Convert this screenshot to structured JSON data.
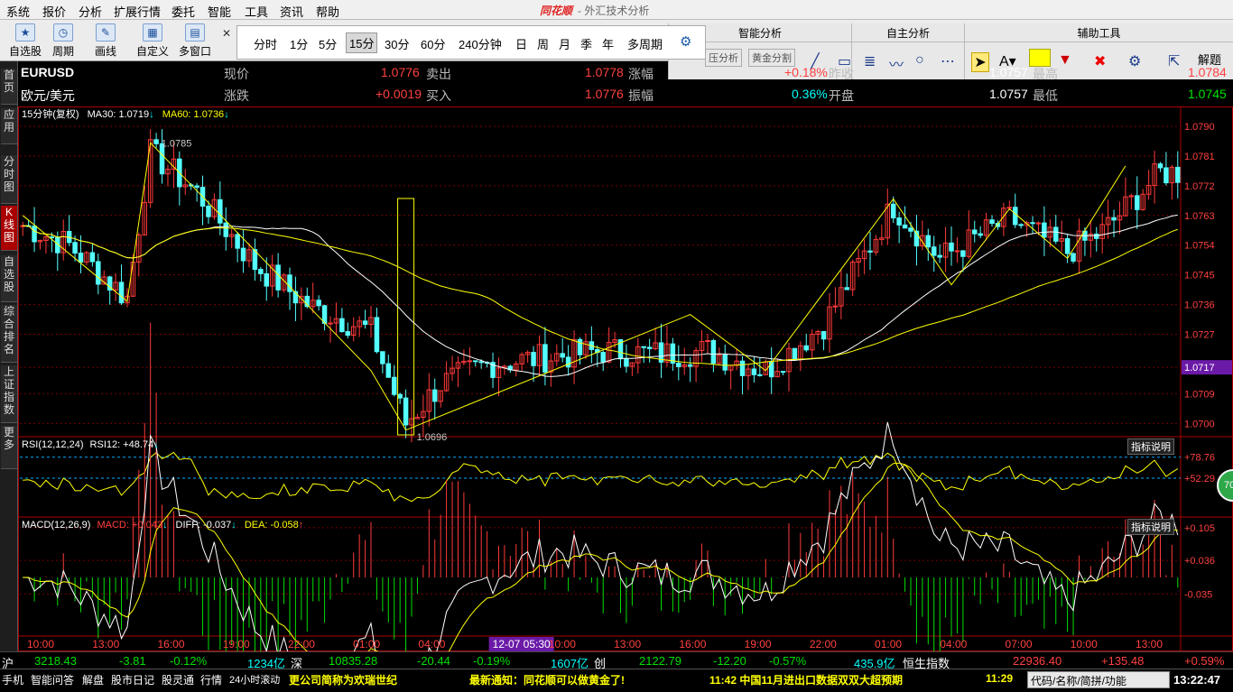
{
  "menu": [
    "系统",
    "报价",
    "分析",
    "扩展行情",
    "委托",
    "智能",
    "工具",
    "资讯",
    "帮助"
  ],
  "app_title": {
    "brand": "同花顺",
    "subtitle": "- 外汇技术分析"
  },
  "toolbar": {
    "buttons": [
      {
        "label": "自选股",
        "icon": "star-icon"
      },
      {
        "label": "周期",
        "icon": "clock-icon"
      },
      {
        "label": "画线",
        "icon": "pen-icon"
      },
      {
        "label": "自定义",
        "icon": "grid-icon"
      },
      {
        "label": "多窗口",
        "icon": "window-icon"
      }
    ],
    "periods": [
      "分时",
      "1分",
      "5分",
      "15分",
      "30分",
      "60分",
      "240分钟",
      "日",
      "周",
      "月",
      "季",
      "年",
      "多周期"
    ],
    "selected_period": "15分",
    "sections": [
      {
        "title": "智能分析",
        "buttons": [
          "压分析",
          "黄金分割"
        ]
      },
      {
        "title": "自主分析"
      },
      {
        "title": "辅助工具",
        "last": "解题"
      }
    ]
  },
  "leftnav": [
    "首页",
    "应用",
    "分时图",
    "K线图",
    "自选股",
    "综合排名",
    "上证指数",
    "更多"
  ],
  "quote": {
    "symbol": "EURUSD",
    "name": "欧元/美元",
    "labels": {
      "price": "现价",
      "change": "涨跌",
      "sell": "卖出",
      "buy": "买入",
      "pct": "涨幅",
      "amp": "振幅",
      "prev": "昨收",
      "open": "开盘",
      "high": "最高",
      "low": "最低"
    },
    "price": "1.0776",
    "change": "+0.0019",
    "sell": "1.0778",
    "buy": "1.0776",
    "pct": "+0.18%",
    "amp": "0.36%",
    "prev": "1.0757",
    "open": "1.0757",
    "high": "1.0784",
    "low": "1.0745"
  },
  "ma": {
    "period_label": "15分钟(复权)",
    "ma30": "MA30: 1.0719",
    "ma60": "MA60: 1.0736"
  },
  "chart_data": {
    "type": "candlestick",
    "ylim": [
      1.0696,
      1.079
    ],
    "y_ticks": [
      "1.0790",
      "1.0781",
      "1.0772",
      "1.0763",
      "1.0754",
      "1.0745",
      "1.0736",
      "1.0727",
      "1.0717",
      "1.0709",
      "1.0700"
    ],
    "x_ticks": [
      "10:00",
      "13:00",
      "16:00",
      "19:00",
      "22:00",
      "01:00",
      "04:00",
      "12-07 05:30",
      "10:00",
      "13:00",
      "16:00",
      "19:00",
      "22:00",
      "01:00",
      "04:00",
      "07:00",
      "10:00",
      "13:00"
    ],
    "highlight_price": "1.0717",
    "annotations": {
      "high": "1.0785",
      "low": "1.0696"
    },
    "zigzag": [
      [
        0,
        1.0763
      ],
      [
        18,
        1.0737
      ],
      [
        22,
        1.0785
      ],
      [
        60,
        1.0716
      ],
      [
        66,
        1.0698
      ],
      [
        115,
        1.0733
      ],
      [
        128,
        1.0716
      ],
      [
        150,
        1.0768
      ],
      [
        160,
        1.0742
      ],
      [
        170,
        1.0765
      ],
      [
        180,
        1.075
      ],
      [
        190,
        1.0778
      ]
    ],
    "close_anchors": [
      [
        0,
        1.076
      ],
      [
        8,
        1.0754
      ],
      [
        18,
        1.0738
      ],
      [
        22,
        1.0782
      ],
      [
        30,
        1.077
      ],
      [
        40,
        1.0748
      ],
      [
        50,
        1.0735
      ],
      [
        60,
        1.0728
      ],
      [
        66,
        1.07
      ],
      [
        72,
        1.0712
      ],
      [
        80,
        1.0718
      ],
      [
        90,
        1.072
      ],
      [
        100,
        1.0722
      ],
      [
        110,
        1.0721
      ],
      [
        118,
        1.0722
      ],
      [
        128,
        1.0716
      ],
      [
        138,
        1.073
      ],
      [
        150,
        1.0766
      ],
      [
        158,
        1.075
      ],
      [
        170,
        1.0762
      ],
      [
        180,
        1.0752
      ],
      [
        186,
        1.0758
      ],
      [
        196,
        1.0776
      ]
    ],
    "rsi": {
      "label": "RSI(12,12,24)",
      "value": "RSI12: +48.74",
      "levels": [
        "+78.76",
        "+52.29"
      ],
      "current": 70
    },
    "macd": {
      "label": "MACD(12,26,9)",
      "macd": "MACD: +0.043",
      "diff": "DIFF: -0.037",
      "dea": "DEA: -0.058",
      "levels": [
        "+0.105",
        "+0.036",
        "-0.035"
      ]
    }
  },
  "indicator_button": "指标说明",
  "ticker": [
    {
      "t": "沪",
      "c": "wht"
    },
    {
      "t": "3218.43",
      "c": "grn"
    },
    {
      "t": "-3.81",
      "c": "grn"
    },
    {
      "t": "-0.12%",
      "c": "grn"
    },
    {
      "t": "1234亿",
      "c": "cyn"
    },
    {
      "t": "深",
      "c": "wht"
    },
    {
      "t": "10835.28",
      "c": "grn"
    },
    {
      "t": "-20.44",
      "c": "grn"
    },
    {
      "t": "-0.19%",
      "c": "grn"
    },
    {
      "t": "1607亿",
      "c": "cyn"
    },
    {
      "t": "创",
      "c": "wht"
    },
    {
      "t": "2122.79",
      "c": "grn"
    },
    {
      "t": "-12.20",
      "c": "grn"
    },
    {
      "t": "-0.57%",
      "c": "grn"
    },
    {
      "t": "435.9亿",
      "c": "cyn"
    },
    {
      "t": "恒生指数",
      "c": "wht"
    },
    {
      "t": "22936.40",
      "c": "red"
    },
    {
      "t": "+135.48",
      "c": "red"
    },
    {
      "t": "+0.59%",
      "c": "red"
    }
  ],
  "status": {
    "left": [
      "手机",
      "智能问答",
      "解盘",
      "股市日记",
      "股灵通",
      "行情",
      "24小时滚动"
    ],
    "news": [
      "更公司简称为欢瑞世纪",
      "最新通知：同花顺可以做黄金了!",
      "11:42 中国11月进出口数据双双大超预期",
      "11:29"
    ],
    "search": "代码/名称/简拼/功能",
    "time": "13:22:47"
  }
}
